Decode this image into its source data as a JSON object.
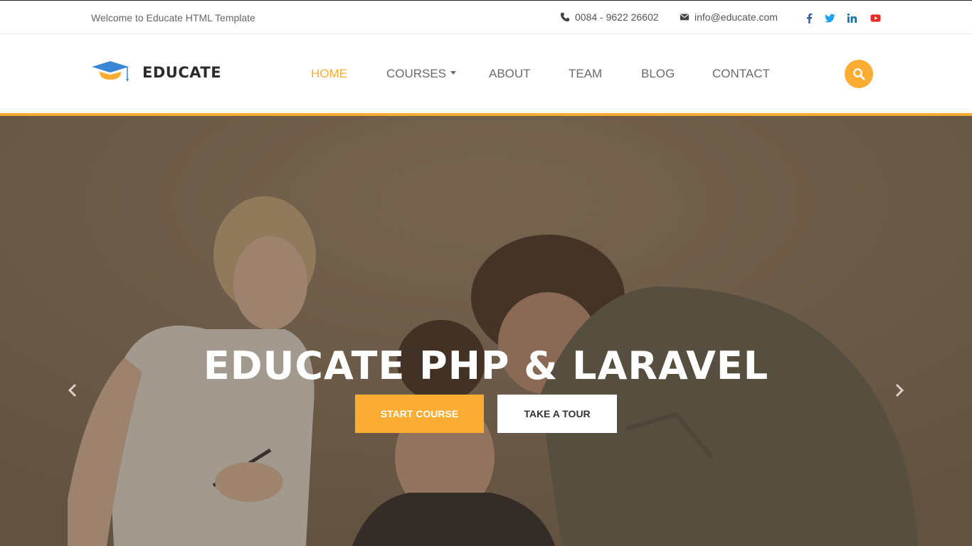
{
  "topbar": {
    "welcome": "Welcome to Educate HTML Template",
    "phone": "0084 - 9622 26602",
    "email": "info@educate.com",
    "social": [
      "facebook-icon",
      "twitter-icon",
      "linkedin-icon",
      "youtube-icon"
    ]
  },
  "header": {
    "logo_text": "EDUCATE",
    "nav": {
      "home": "HOME",
      "courses": "COURSES",
      "about": "ABOUT",
      "team": "TEAM",
      "blog": "BLOG",
      "contact": "CONTACT"
    },
    "active_item": "home"
  },
  "hero": {
    "title": "EDUCATE PHP & LARAVEL",
    "start_label": "START COURSE",
    "tour_label": "TAKE A TOUR"
  },
  "colors": {
    "accent": "#fbad33",
    "facebook": "#3b5998",
    "twitter": "#1da1f2",
    "linkedin": "#0e76a8",
    "youtube": "#e52d27"
  }
}
